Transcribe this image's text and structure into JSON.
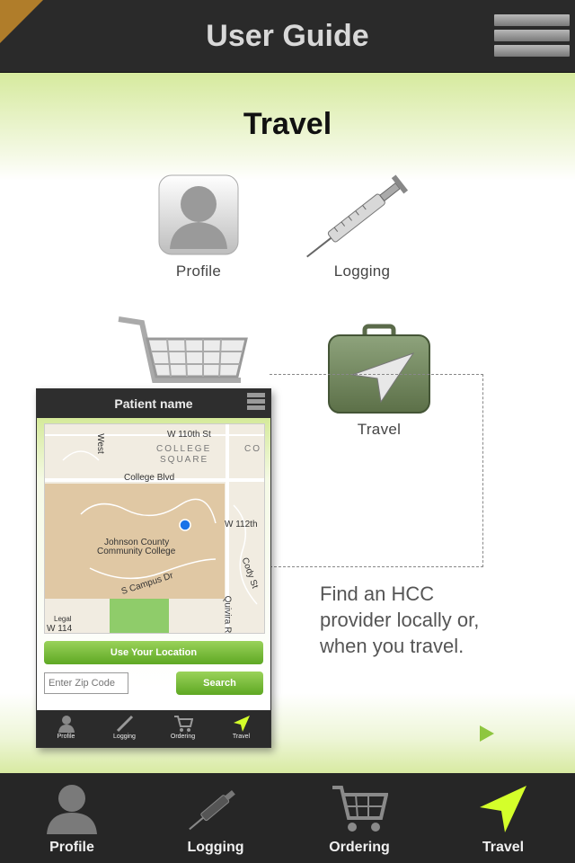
{
  "header": {
    "title": "User Guide"
  },
  "guide": {
    "section_title": "Travel",
    "menu": {
      "profile": "Profile",
      "logging": "Logging",
      "travel": "Travel"
    },
    "description": "Find an HCC provider locally or, when you travel."
  },
  "preview": {
    "title": "Patient name",
    "map_labels": {
      "w110": "W 110th St",
      "college_square_1": "COLLEGE",
      "college_square_2": "SQUARE",
      "co": "CO",
      "college_blvd": "College Blvd",
      "w112": "W 112th",
      "jcc_1": "Johnson County",
      "jcc_2": "Community College",
      "campus": "S Campus Dr",
      "cody": "Cody St",
      "quivira": "Quivira R",
      "legal": "Legal",
      "w114": "W 114",
      "west": "West"
    },
    "use_location": "Use Your Location",
    "zip_placeholder": "Enter Zip Code",
    "search": "Search",
    "tabs": [
      "Profile",
      "Logging",
      "Ordering",
      "Travel"
    ]
  },
  "tabbar": {
    "tabs": [
      {
        "label": "Profile",
        "icon": "person-icon"
      },
      {
        "label": "Logging",
        "icon": "syringe-icon"
      },
      {
        "label": "Ordering",
        "icon": "cart-icon"
      },
      {
        "label": "Travel",
        "icon": "navigation-arrow-icon"
      }
    ],
    "active_tab": "Travel",
    "active_color": "#d4ff2a"
  }
}
